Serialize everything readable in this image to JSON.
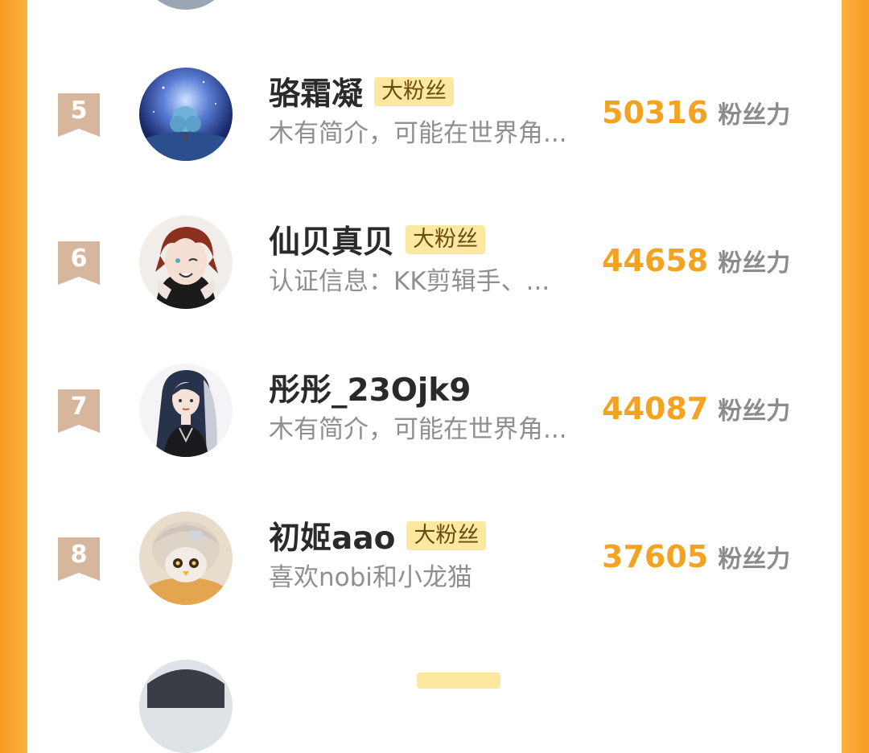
{
  "ranking": [
    {
      "rank": "5",
      "name": "骆霜凝",
      "badge": "大粉丝",
      "description": "木有简介，可能在世界角...",
      "score": "50316",
      "score_unit": "粉丝力",
      "avatar": "galaxy-tree-avatar"
    },
    {
      "rank": "6",
      "name": "仙贝真贝",
      "badge": "大粉丝",
      "description": "认证信息：KK剪辑手、...",
      "score": "44658",
      "score_unit": "粉丝力",
      "avatar": "anime-boy-avatar"
    },
    {
      "rank": "7",
      "name": "彤彤_23Ojk9",
      "badge": "",
      "description": "木有简介，可能在世界角...",
      "score": "44087",
      "score_unit": "粉丝力",
      "avatar": "anime-girl-avatar"
    },
    {
      "rank": "8",
      "name": "初姬aao",
      "badge": "大粉丝",
      "description": "喜欢nobi和小龙猫",
      "score": "37605",
      "score_unit": "粉丝力",
      "avatar": "plush-doll-avatar"
    }
  ],
  "colors": {
    "accent": "#f2a322",
    "frame": "#fcb23d",
    "rank_ribbon": "#d6b79d",
    "badge_bg": "#fde8a2"
  }
}
